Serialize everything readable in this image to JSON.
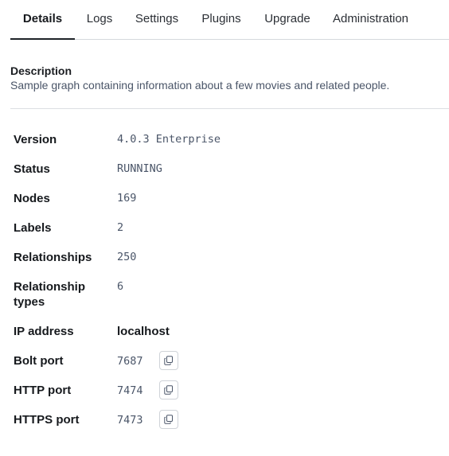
{
  "tabs": [
    {
      "label": "Details",
      "active": true
    },
    {
      "label": "Logs",
      "active": false
    },
    {
      "label": "Settings",
      "active": false
    },
    {
      "label": "Plugins",
      "active": false
    },
    {
      "label": "Upgrade",
      "active": false
    },
    {
      "label": "Administration",
      "active": false
    }
  ],
  "description": {
    "title": "Description",
    "text": "Sample graph containing information about a few movies and related people."
  },
  "properties": {
    "version": {
      "label": "Version",
      "value": "4.0.3 Enterprise"
    },
    "status": {
      "label": "Status",
      "value": "RUNNING"
    },
    "nodes": {
      "label": "Nodes",
      "value": "169"
    },
    "labels": {
      "label": "Labels",
      "value": "2"
    },
    "relationships": {
      "label": "Relationships",
      "value": "250"
    },
    "relationship_types": {
      "label_line1": "Relationship",
      "label_line2": "types",
      "value": "6"
    },
    "ip_address": {
      "label": "IP address",
      "value": "localhost"
    },
    "bolt_port": {
      "label": "Bolt port",
      "value": "7687",
      "copy_icon": "copy-icon"
    },
    "http_port": {
      "label": "HTTP port",
      "value": "7474",
      "copy_icon": "copy-icon"
    },
    "https_port": {
      "label": "HTTPS port",
      "value": "7473",
      "copy_icon": "copy-icon"
    }
  },
  "colors": {
    "text_primary": "#16191d",
    "text_secondary": "#4a5568",
    "border": "#d5d8dc"
  }
}
